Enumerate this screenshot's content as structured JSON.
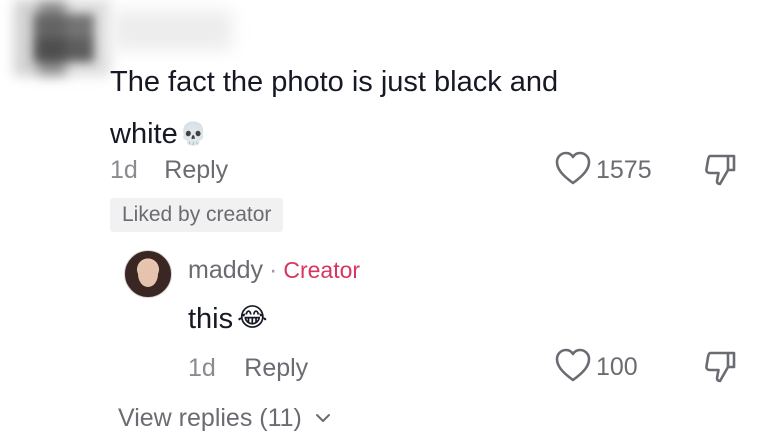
{
  "comment": {
    "text": "The fact the photo is just black and white",
    "emoji": "💀",
    "age": "1d",
    "reply_label": "Reply",
    "like_count": "1575",
    "liked_badge": "Liked by creator"
  },
  "reply": {
    "author": "maddy",
    "separator": "·",
    "author_tag": "Creator",
    "text": "this",
    "emoji": "😂",
    "age": "1d",
    "reply_label": "Reply",
    "like_count": "100"
  },
  "thread": {
    "view_replies_label": "View replies (11)"
  },
  "colors": {
    "creator_tag": "#d6365f",
    "muted_text": "#6b6c72",
    "primary_text": "#161823"
  }
}
